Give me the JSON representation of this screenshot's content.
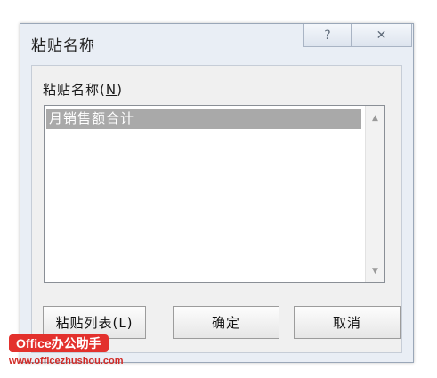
{
  "window": {
    "title": "粘贴名称",
    "help_glyph": "?",
    "close_glyph": "✕"
  },
  "list": {
    "label_text": "粘贴名称(",
    "label_mnemonic": "N",
    "label_close": ")",
    "items": [
      "月销售额合计"
    ],
    "selected_index": 0
  },
  "buttons": {
    "paste_list": "粘贴列表(L)",
    "ok": "确定",
    "cancel": "取消"
  },
  "watermark": {
    "badge": "Office办公助手",
    "url": "www.officezhushou.com"
  },
  "colors": {
    "selection": "#a9a9a9",
    "watermark_red": "#e3312d"
  }
}
